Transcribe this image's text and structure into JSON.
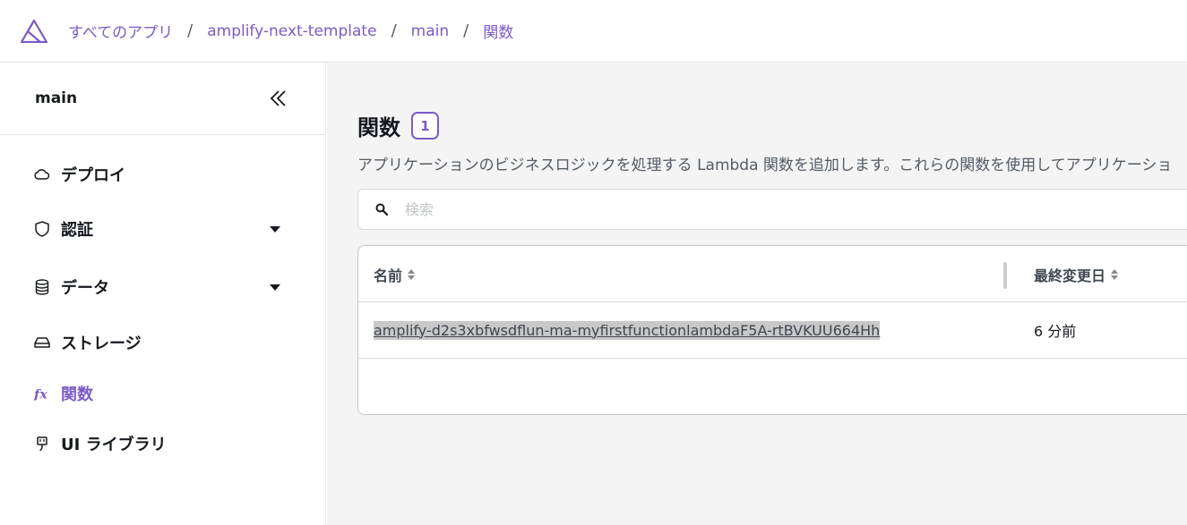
{
  "breadcrumbs": [
    "すべてのアプリ",
    "amplify-next-template",
    "main",
    "関数"
  ],
  "breadcrumb_separator": "/",
  "sidebar": {
    "title": "main",
    "items": [
      {
        "label": "デプロイ",
        "icon": "cloud-icon",
        "expandable": false,
        "active": false
      },
      {
        "label": "認証",
        "icon": "shield-icon",
        "expandable": true,
        "active": false
      },
      {
        "label": "データ",
        "icon": "database-icon",
        "expandable": true,
        "active": false
      },
      {
        "label": "ストレージ",
        "icon": "storage-drive-icon",
        "expandable": false,
        "active": false
      },
      {
        "label": "関数",
        "icon": "function-fx-icon",
        "expandable": false,
        "active": true
      },
      {
        "label": "UI ライブラリ",
        "icon": "plug-icon",
        "expandable": false,
        "active": false
      }
    ]
  },
  "main": {
    "title": "関数",
    "count": "1",
    "description": "アプリケーションのビジネスロジックを処理する Lambda 関数を追加します。これらの関数を使用してアプリケーショ",
    "search": {
      "placeholder": "検索",
      "value": ""
    },
    "table": {
      "columns": [
        "名前",
        "最終変更日"
      ],
      "rows": [
        {
          "name": "amplify-d2s3xbfwsdflun-ma-myfirstfunctionlambdaF5A-rtBVKUU664Hh",
          "modified": "6 分前"
        }
      ]
    }
  },
  "colors": {
    "accent": "#7a5bc7",
    "main_background": "#f4f4f4",
    "text": "#16191f"
  }
}
